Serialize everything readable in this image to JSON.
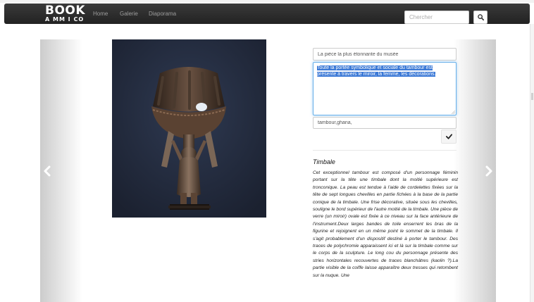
{
  "navbar": {
    "brand_line1": "BOOK",
    "brand_line2": "A MM I CO",
    "links": [
      "Home",
      "Galerie",
      "Diaporama"
    ],
    "search_placeholder": "Chercher",
    "search_icon": "search-icon"
  },
  "form": {
    "title_value": "La pièce la plus étonnante du musée",
    "description_value": "Toute la portée symbolique et sociale du tambour est présente à travers le miroir, la femme, les décorations.",
    "tags_value": "tambour,ghana,",
    "validate_icon": "check-icon"
  },
  "artwork": {
    "title": "Timbale",
    "description": "Cet exceptionnel tambour est composé d'un personnage féminin portant sur la tête une timbale dont la moitié supérieure est tronconique. La peau est tendue à l'aide de cordelettes fixées sur la tête de sept longues chevilles en partie fichées à la base de la partie conique de la timbale. Une frise décorative, située sous les chevilles, souligne le bord supérieur de l'autre moitié de la timbale. Une pièce de verre (un miroir) ovale est fixée à ce niveau sur la face antérieure de l'instrument.Deux larges bandes de toile enserrent les bras de la figurine et rejoignent en un même point le sommet de la timbale. Il s'agit probablement d'un dispositif destiné à porter le tambour. Des traces de polychromie apparaissent ici et là sur la timbale comme sur le corps de la sculpture. Le long cou du personnage présente des stries horizontales recouvertes de traces blanchâtres (kaolin ?).La partie visible de la coiffe laisse apparaître deux tresses qui retombent sur la nuque. Une"
  },
  "carousel": {
    "prev_icon": "chevron-left-icon",
    "next_icon": "chevron-right-icon"
  },
  "colors": {
    "navbar_bg": "#222222",
    "focus_border": "#66afe9",
    "selection": "#3a78d6",
    "artwork_bg": "#232a3a"
  }
}
